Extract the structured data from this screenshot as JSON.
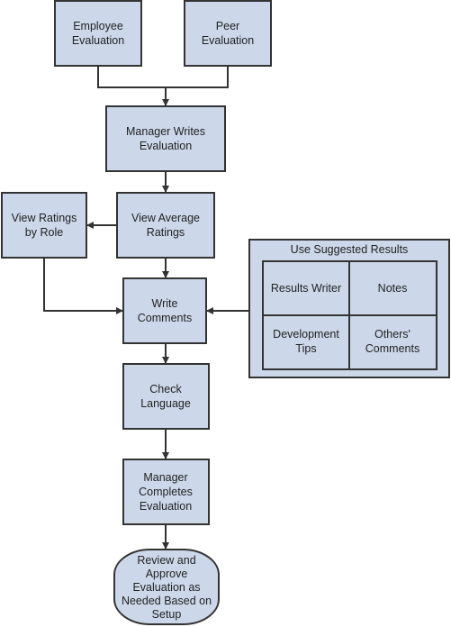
{
  "nodes": {
    "employee_eval": [
      "Employee",
      "Evaluation"
    ],
    "peer_eval": [
      "Peer",
      "Evaluation"
    ],
    "manager_writes": [
      "Manager Writes",
      "Evaluation"
    ],
    "view_average": [
      "View Average",
      "Ratings"
    ],
    "view_by_role": [
      "View Ratings",
      "by Role"
    ],
    "write_comments": [
      "Write",
      "Comments"
    ],
    "check_language": [
      "Check",
      "Language"
    ],
    "manager_completes": [
      "Manager",
      "Completes",
      "Evaluation"
    ],
    "review_approve": [
      "Review and",
      "Approve",
      "Evaluation as",
      "Needed Based on",
      "Setup"
    ]
  },
  "suggested": {
    "title": "Use Suggested Results",
    "results_writer": [
      "Results Writer"
    ],
    "notes": [
      "Notes"
    ],
    "development_tips": [
      "Development",
      "Tips"
    ],
    "others_comments": [
      "Others'",
      "Comments"
    ]
  }
}
